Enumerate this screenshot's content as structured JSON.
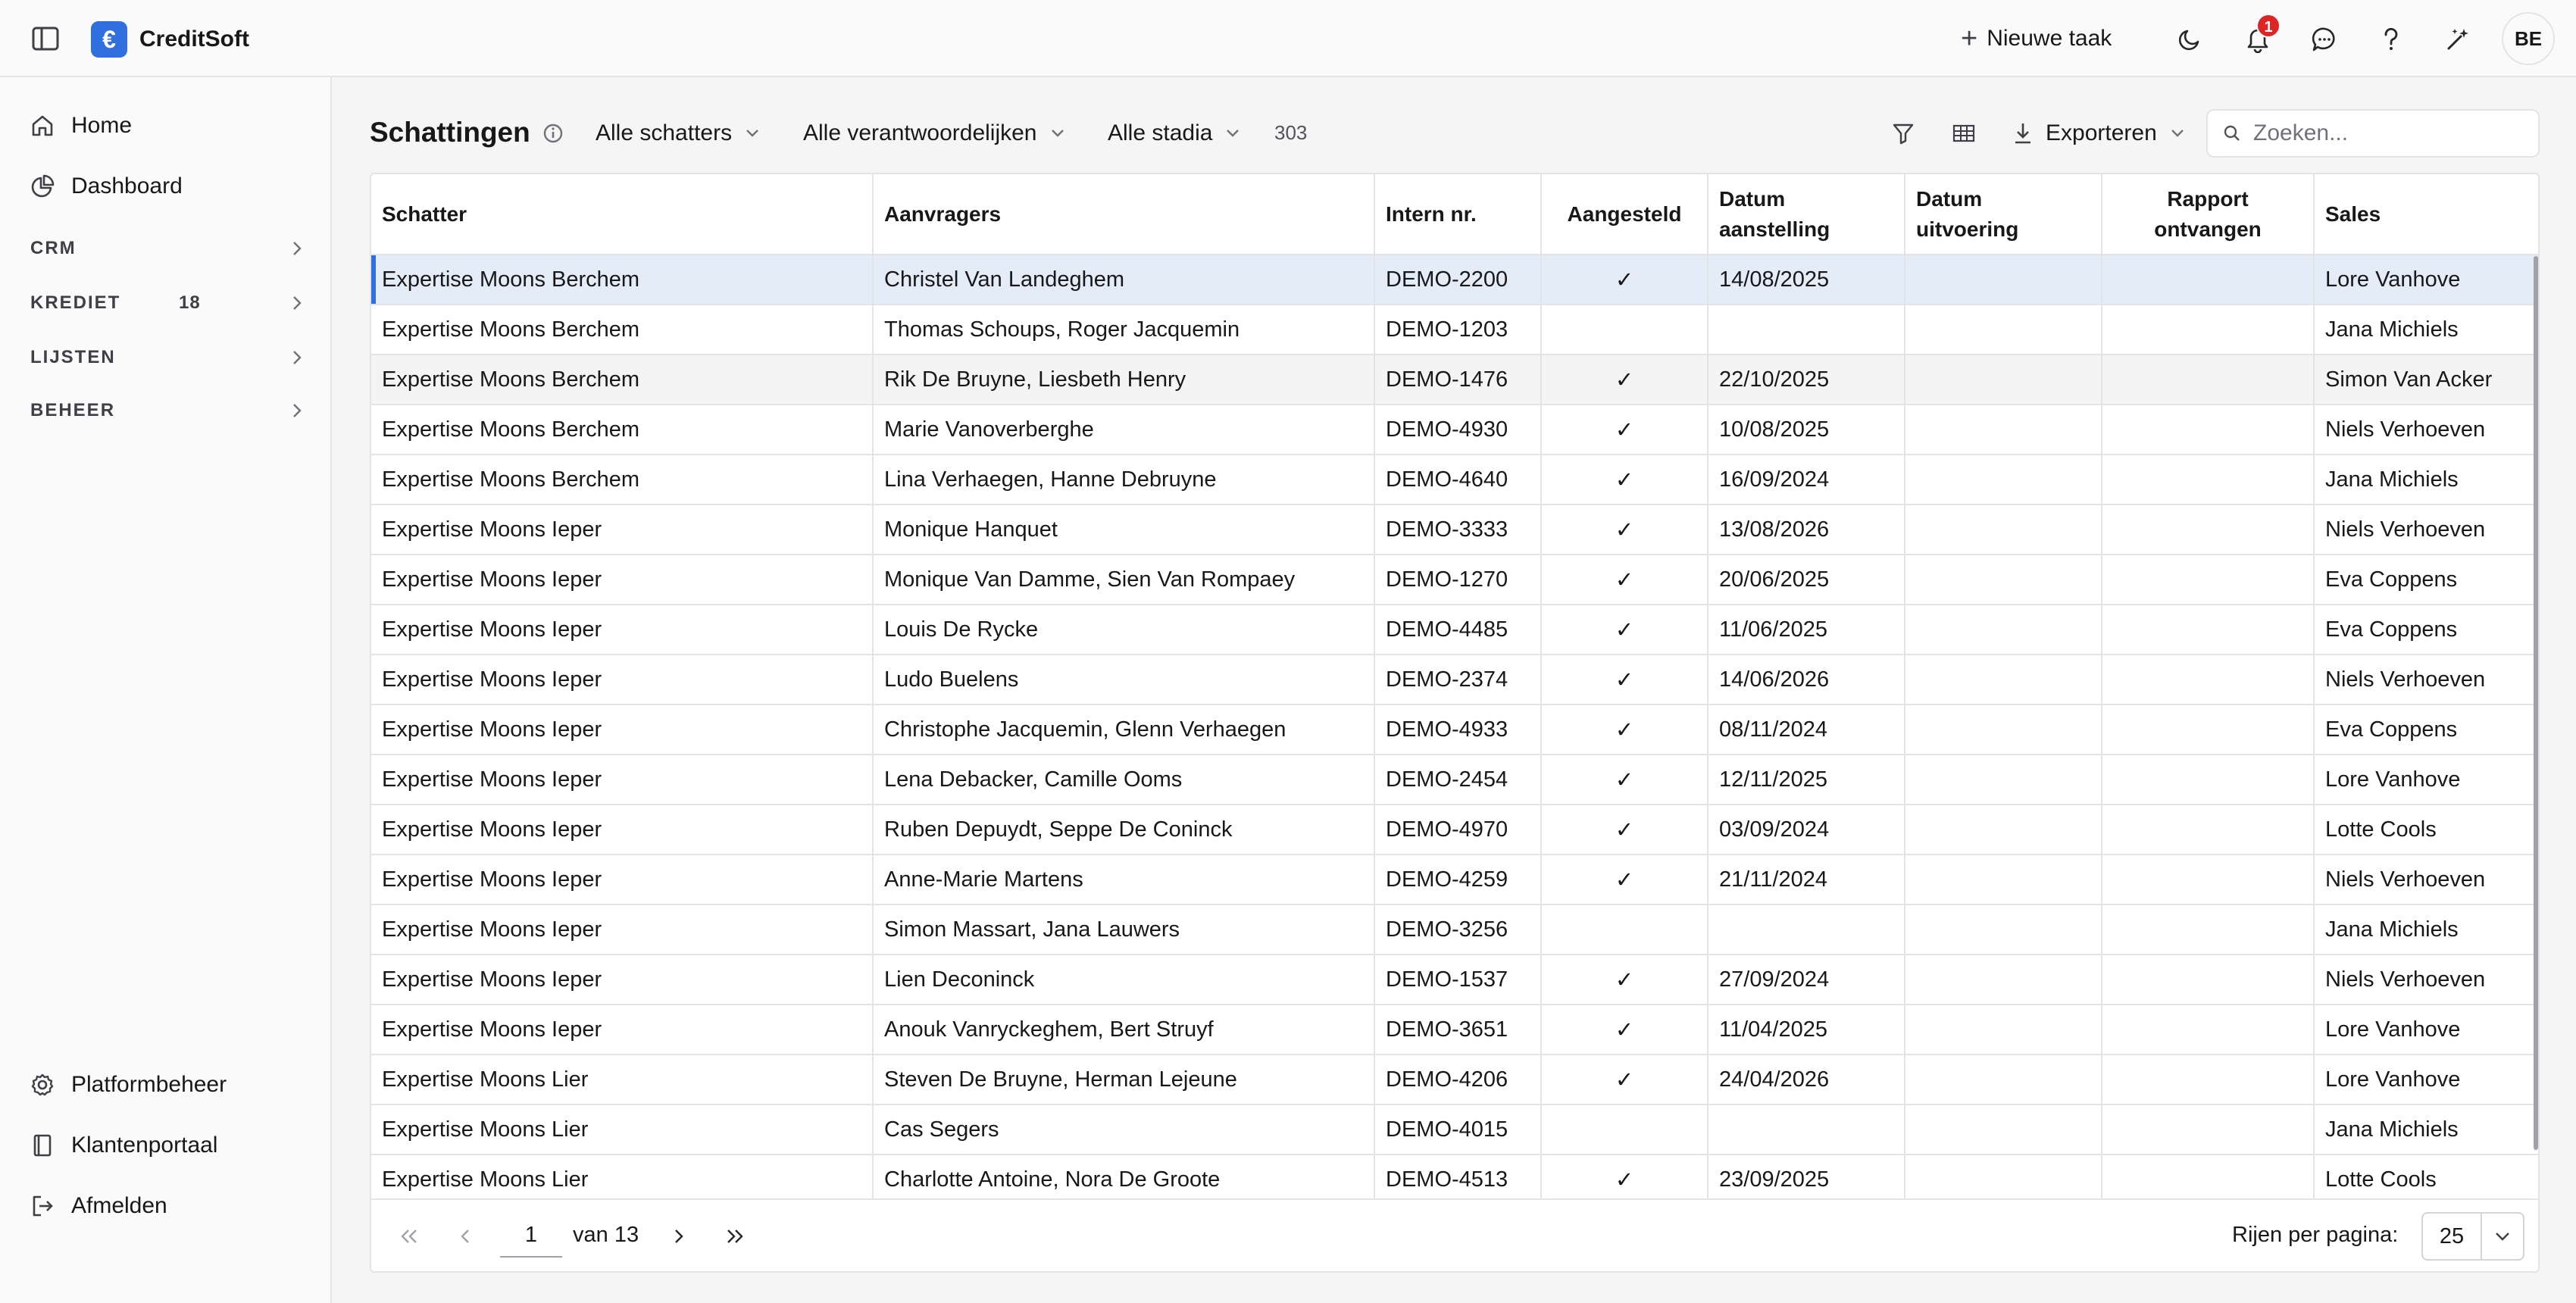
{
  "app": {
    "name": "CreditSoft",
    "logo_glyph": "€",
    "brand_color": "#2f6fde"
  },
  "topbar": {
    "new_task_label": "Nieuwe taak",
    "notification_count": "1",
    "avatar_initials": "BE"
  },
  "sidebar": {
    "items": [
      {
        "label": "Home",
        "icon": "home-icon"
      },
      {
        "label": "Dashboard",
        "icon": "pie-chart-icon"
      }
    ],
    "groups": [
      {
        "label": "CRM",
        "count": ""
      },
      {
        "label": "KREDIET",
        "count": "18"
      },
      {
        "label": "LIJSTEN",
        "count": ""
      },
      {
        "label": "BEHEER",
        "count": ""
      }
    ],
    "bottom_items": [
      {
        "label": "Platformbeheer",
        "icon": "gear-icon"
      },
      {
        "label": "Klantenportaal",
        "icon": "book-icon"
      },
      {
        "label": "Afmelden",
        "icon": "logout-icon"
      }
    ]
  },
  "toolbar": {
    "title": "Schattingen",
    "filters": [
      "Alle schatters",
      "Alle verantwoordelijken",
      "Alle stadia"
    ],
    "count": "303",
    "export_label": "Exporteren",
    "search_placeholder": "Zoeken..."
  },
  "table": {
    "columns": [
      "Schatter",
      "Aanvragers",
      "Intern nr.",
      "Aangesteld",
      "Datum aanstelling",
      "Datum uitvoering",
      "Rapport ontvangen",
      "Sales"
    ],
    "column_lines": [
      [
        "Schatter"
      ],
      [
        "Aanvragers"
      ],
      [
        "Intern nr."
      ],
      [
        "Aangesteld"
      ],
      [
        "Datum",
        "aanstelling"
      ],
      [
        "Datum",
        "uitvoering"
      ],
      [
        "Rapport",
        "ontvangen"
      ],
      [
        "Sales"
      ]
    ],
    "check_glyph": "✓",
    "rows": [
      {
        "schatter": "Expertise Moons Berchem",
        "aanvragers": "Christel Van Landeghem",
        "intern_nr": "DEMO-2200",
        "aangesteld": true,
        "datum_aanstelling": "14/08/2025",
        "datum_uitvoering": "",
        "rapport_ontvangen": "",
        "sales": "Lore Vanhove",
        "state": "selected"
      },
      {
        "schatter": "Expertise Moons Berchem",
        "aanvragers": "Thomas Schoups, Roger Jacquemin",
        "intern_nr": "DEMO-1203",
        "aangesteld": false,
        "datum_aanstelling": "",
        "datum_uitvoering": "",
        "rapport_ontvangen": "",
        "sales": "Jana Michiels",
        "state": ""
      },
      {
        "schatter": "Expertise Moons Berchem",
        "aanvragers": "Rik De Bruyne, Liesbeth Henry",
        "intern_nr": "DEMO-1476",
        "aangesteld": true,
        "datum_aanstelling": "22/10/2025",
        "datum_uitvoering": "",
        "rapport_ontvangen": "",
        "sales": "Simon Van Acker",
        "state": "hover"
      },
      {
        "schatter": "Expertise Moons Berchem",
        "aanvragers": "Marie Vanoverberghe",
        "intern_nr": "DEMO-4930",
        "aangesteld": true,
        "datum_aanstelling": "10/08/2025",
        "datum_uitvoering": "",
        "rapport_ontvangen": "",
        "sales": "Niels Verhoeven",
        "state": ""
      },
      {
        "schatter": "Expertise Moons Berchem",
        "aanvragers": "Lina Verhaegen, Hanne Debruyne",
        "intern_nr": "DEMO-4640",
        "aangesteld": true,
        "datum_aanstelling": "16/09/2024",
        "datum_uitvoering": "",
        "rapport_ontvangen": "",
        "sales": "Jana Michiels",
        "state": ""
      },
      {
        "schatter": "Expertise Moons Ieper",
        "aanvragers": "Monique Hanquet",
        "intern_nr": "DEMO-3333",
        "aangesteld": true,
        "datum_aanstelling": "13/08/2026",
        "datum_uitvoering": "",
        "rapport_ontvangen": "",
        "sales": "Niels Verhoeven",
        "state": ""
      },
      {
        "schatter": "Expertise Moons Ieper",
        "aanvragers": "Monique Van Damme, Sien Van Rompaey",
        "intern_nr": "DEMO-1270",
        "aangesteld": true,
        "datum_aanstelling": "20/06/2025",
        "datum_uitvoering": "",
        "rapport_ontvangen": "",
        "sales": "Eva Coppens",
        "state": ""
      },
      {
        "schatter": "Expertise Moons Ieper",
        "aanvragers": "Louis De Rycke",
        "intern_nr": "DEMO-4485",
        "aangesteld": true,
        "datum_aanstelling": "11/06/2025",
        "datum_uitvoering": "",
        "rapport_ontvangen": "",
        "sales": "Eva Coppens",
        "state": ""
      },
      {
        "schatter": "Expertise Moons Ieper",
        "aanvragers": "Ludo Buelens",
        "intern_nr": "DEMO-2374",
        "aangesteld": true,
        "datum_aanstelling": "14/06/2026",
        "datum_uitvoering": "",
        "rapport_ontvangen": "",
        "sales": "Niels Verhoeven",
        "state": ""
      },
      {
        "schatter": "Expertise Moons Ieper",
        "aanvragers": "Christophe Jacquemin, Glenn Verhaegen",
        "intern_nr": "DEMO-4933",
        "aangesteld": true,
        "datum_aanstelling": "08/11/2024",
        "datum_uitvoering": "",
        "rapport_ontvangen": "",
        "sales": "Eva Coppens",
        "state": ""
      },
      {
        "schatter": "Expertise Moons Ieper",
        "aanvragers": "Lena Debacker, Camille Ooms",
        "intern_nr": "DEMO-2454",
        "aangesteld": true,
        "datum_aanstelling": "12/11/2025",
        "datum_uitvoering": "",
        "rapport_ontvangen": "",
        "sales": "Lore Vanhove",
        "state": ""
      },
      {
        "schatter": "Expertise Moons Ieper",
        "aanvragers": "Ruben Depuydt, Seppe De Coninck",
        "intern_nr": "DEMO-4970",
        "aangesteld": true,
        "datum_aanstelling": "03/09/2024",
        "datum_uitvoering": "",
        "rapport_ontvangen": "",
        "sales": "Lotte Cools",
        "state": ""
      },
      {
        "schatter": "Expertise Moons Ieper",
        "aanvragers": "Anne-Marie Martens",
        "intern_nr": "DEMO-4259",
        "aangesteld": true,
        "datum_aanstelling": "21/11/2024",
        "datum_uitvoering": "",
        "rapport_ontvangen": "",
        "sales": "Niels Verhoeven",
        "state": ""
      },
      {
        "schatter": "Expertise Moons Ieper",
        "aanvragers": "Simon Massart, Jana Lauwers",
        "intern_nr": "DEMO-3256",
        "aangesteld": false,
        "datum_aanstelling": "",
        "datum_uitvoering": "",
        "rapport_ontvangen": "",
        "sales": "Jana Michiels",
        "state": ""
      },
      {
        "schatter": "Expertise Moons Ieper",
        "aanvragers": "Lien Deconinck",
        "intern_nr": "DEMO-1537",
        "aangesteld": true,
        "datum_aanstelling": "27/09/2024",
        "datum_uitvoering": "",
        "rapport_ontvangen": "",
        "sales": "Niels Verhoeven",
        "state": ""
      },
      {
        "schatter": "Expertise Moons Ieper",
        "aanvragers": "Anouk Vanryckeghem, Bert Struyf",
        "intern_nr": "DEMO-3651",
        "aangesteld": true,
        "datum_aanstelling": "11/04/2025",
        "datum_uitvoering": "",
        "rapport_ontvangen": "",
        "sales": "Lore Vanhove",
        "state": ""
      },
      {
        "schatter": "Expertise Moons Lier",
        "aanvragers": "Steven De Bruyne, Herman Lejeune",
        "intern_nr": "DEMO-4206",
        "aangesteld": true,
        "datum_aanstelling": "24/04/2026",
        "datum_uitvoering": "",
        "rapport_ontvangen": "",
        "sales": "Lore Vanhove",
        "state": ""
      },
      {
        "schatter": "Expertise Moons Lier",
        "aanvragers": "Cas Segers",
        "intern_nr": "DEMO-4015",
        "aangesteld": false,
        "datum_aanstelling": "",
        "datum_uitvoering": "",
        "rapport_ontvangen": "",
        "sales": "Jana Michiels",
        "state": ""
      },
      {
        "schatter": "Expertise Moons Lier",
        "aanvragers": "Charlotte Antoine, Nora De Groote",
        "intern_nr": "DEMO-4513",
        "aangesteld": true,
        "datum_aanstelling": "23/09/2025",
        "datum_uitvoering": "",
        "rapport_ontvangen": "",
        "sales": "Lotte Cools",
        "state": ""
      }
    ]
  },
  "pagination": {
    "current_page": "1",
    "of_label": "van 13",
    "rows_per_page_label": "Rijen per pagina:",
    "rows_per_page_value": "25"
  }
}
